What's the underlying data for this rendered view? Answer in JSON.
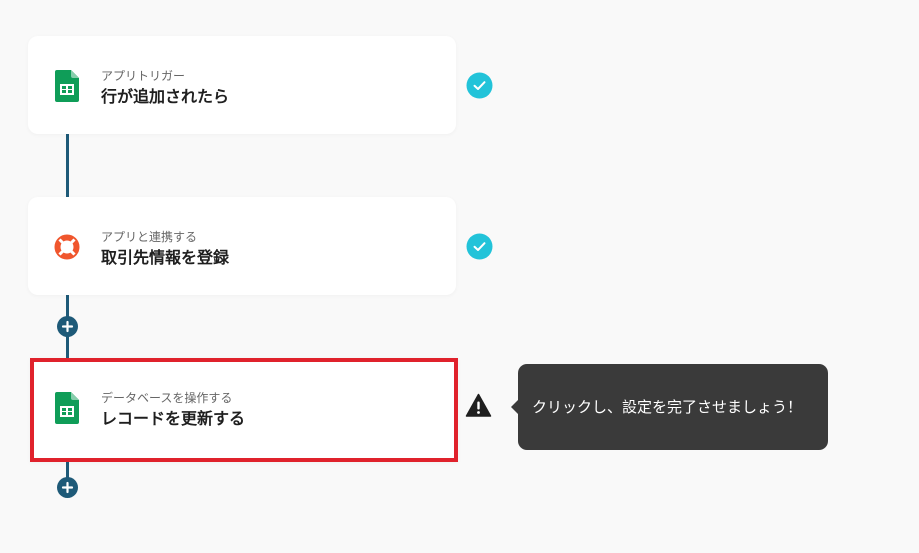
{
  "steps": [
    {
      "subtitle": "アプリトリガー",
      "title": "行が追加されたら",
      "icon": "google-sheets-icon",
      "status": "completed"
    },
    {
      "subtitle": "アプリと連携する",
      "title": "取引先情報を登録",
      "icon": "lifebuoy-icon",
      "status": "completed"
    },
    {
      "subtitle": "データベースを操作する",
      "title": "レコードを更新する",
      "icon": "google-sheets-icon",
      "status": "warning"
    }
  ],
  "tooltip": {
    "text": "クリックし、設定を完了させましょう！"
  },
  "colors": {
    "connector": "#1e5a78",
    "check": "#22c3d9",
    "highlight_border": "#e0222c",
    "tooltip_bg": "#3a3a3a",
    "sheets_green": "#0f9d58",
    "lifebuoy_orange": "#f0562d"
  }
}
